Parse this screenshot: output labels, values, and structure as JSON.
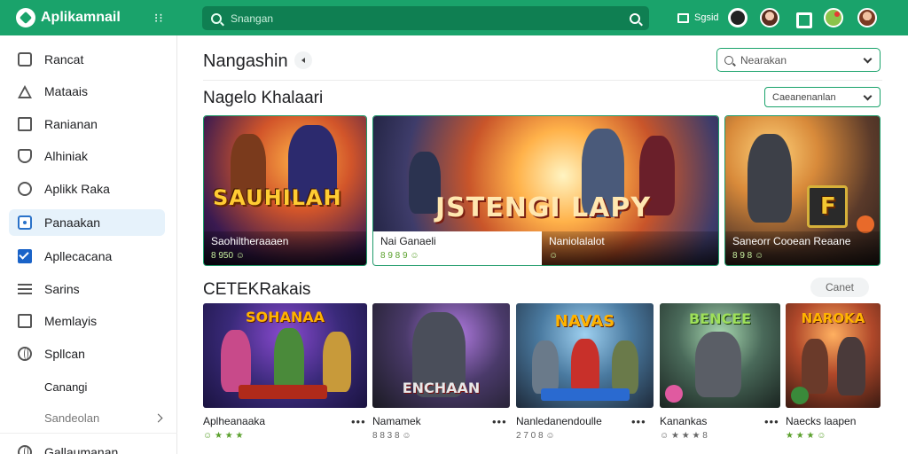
{
  "app": {
    "name": "Aplikamnail",
    "search_placeholder": "Snangan",
    "store_label": "Sgsid"
  },
  "sidebar": {
    "items": [
      {
        "label": "Rancat",
        "icon": "document-icon"
      },
      {
        "label": "Mataais",
        "icon": "warning-icon"
      },
      {
        "label": "Ranianan",
        "icon": "folder-icon"
      },
      {
        "label": "Alhiniak",
        "icon": "shield-icon"
      },
      {
        "label": "Aplikk Raka",
        "icon": "info-icon"
      },
      {
        "label": "Panaakan",
        "icon": "app-icon",
        "active": true
      },
      {
        "label": "Apllecacana",
        "icon": "checkbox-icon"
      },
      {
        "label": "Sarins",
        "icon": "menu-icon"
      },
      {
        "label": "Memlayis",
        "icon": "window-icon"
      },
      {
        "label": "Spllcan",
        "icon": "globe-icon"
      }
    ],
    "sub_items": [
      "Canangi",
      "Sandeolan"
    ],
    "footer_item": "Gallaumanan"
  },
  "main": {
    "page_title": "Nangashin",
    "filter_placeholder": "Nearakan",
    "section1": {
      "title": "Nagelo Khalaari",
      "sort_label": "Caeanenanlan"
    },
    "featured": [
      {
        "art_title": "SAUHILAH",
        "name": "Saohiltheraaaen",
        "meta": "8 950 ☺"
      },
      {
        "art_title": "JSTENGI LAPY",
        "name": "Nai Ganaeli",
        "meta": "8 9 8 9 ☺",
        "name2": "Naniolalalot",
        "meta2": "☺"
      },
      {
        "art_title": "F",
        "name": "Saneorr Cooean Reaane",
        "meta": "8 9 8 ☺"
      }
    ],
    "section2": {
      "title": "CETEKRakais",
      "view_all": "Canet"
    },
    "games": [
      {
        "art_title": "SOHANAA",
        "name": "Aplheanaaka",
        "meta": "☺ ★ ★ ★"
      },
      {
        "art_title": "ENCHAAN",
        "name": "Namamek",
        "meta": "8 8 3 8 ☺"
      },
      {
        "art_title": "NAVAS",
        "name": "Nanledanendoulle",
        "meta": "2 7 0 8 ☺"
      },
      {
        "art_title": "BENCEE",
        "name": "Kanankas",
        "meta": "☺ ★ ★ ★ 8"
      },
      {
        "art_title": "NAROKA",
        "name": "Naecks laapen",
        "meta": "★ ★ ★ ☺"
      }
    ]
  },
  "colors": {
    "brand": "#1aa36b",
    "active": "#e6f2fb",
    "accent": "#1a63c8"
  }
}
